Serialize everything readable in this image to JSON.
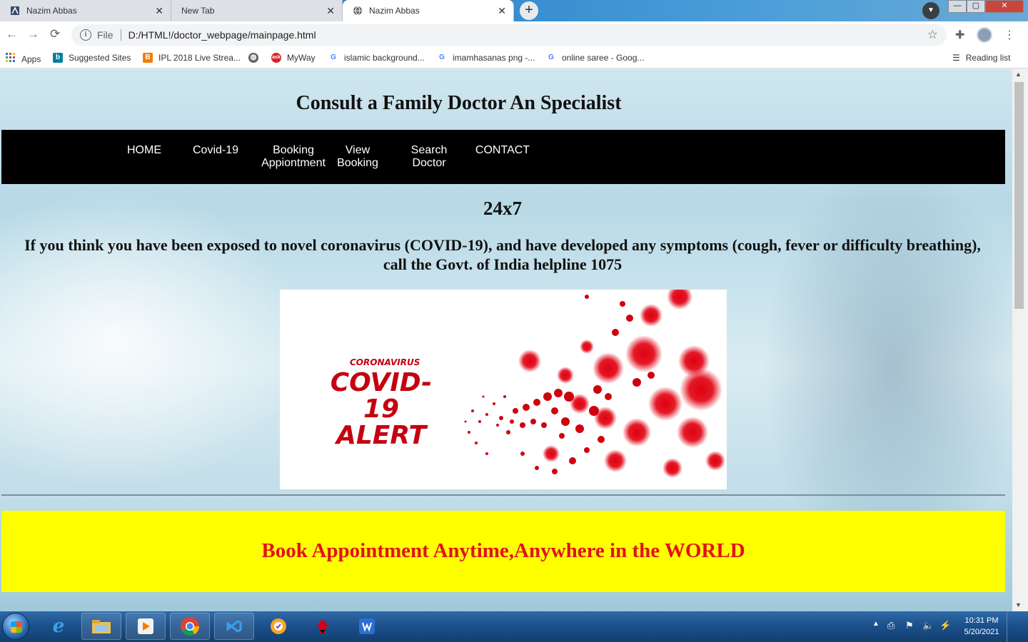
{
  "browser": {
    "tabs": [
      {
        "title": "Nazim Abbas",
        "active": false
      },
      {
        "title": "New Tab",
        "active": false
      },
      {
        "title": "Nazim Abbas",
        "active": true
      }
    ],
    "address": {
      "scheme_label": "File",
      "url": "D:/HTML!/doctor_webpage/mainpage.html"
    },
    "bookmarks": [
      {
        "label": "Apps",
        "icon": "apps-grid-icon"
      },
      {
        "label": "Suggested Sites",
        "icon": "bing-icon"
      },
      {
        "label": "IPL 2018 Live Strea...",
        "icon": "blogger-icon"
      },
      {
        "label": "",
        "icon": "globe-icon"
      },
      {
        "label": "MyWay",
        "icon": "ask-icon"
      },
      {
        "label": "islamic background...",
        "icon": "google-icon"
      },
      {
        "label": "imamhasanas png -...",
        "icon": "google-icon"
      },
      {
        "label": "online saree - Goog...",
        "icon": "google-icon"
      }
    ],
    "reading_list": "Reading list"
  },
  "page": {
    "title": "Consult a Family Doctor An Specialist",
    "nav": [
      {
        "label": "HOME"
      },
      {
        "label": "Covid-19"
      },
      {
        "label": "Booking Appiontment"
      },
      {
        "label": "View Booking"
      },
      {
        "label": "Search Doctor"
      },
      {
        "label": "CONTACT"
      }
    ],
    "tagline": "24x7",
    "notice": "If you think you have been exposed to novel coronavirus (COVID-19), and have developed any symptoms (cough, fever or difficulty breathing), call the Govt. of India helpline 1075",
    "banner": {
      "subtitle": "CORONAVIRUS",
      "headline": "COVID-19 ALERT"
    },
    "slogan": "Book Appointment Anytime,Anywhere in the WORLD"
  },
  "taskbar": {
    "clock_time": "10:31 PM",
    "clock_date": "5/20/2021"
  },
  "colors": {
    "nav_bg": "#000000",
    "slogan_bg": "#ffff00",
    "slogan_text": "#e01414",
    "alert_red": "#c40011"
  }
}
